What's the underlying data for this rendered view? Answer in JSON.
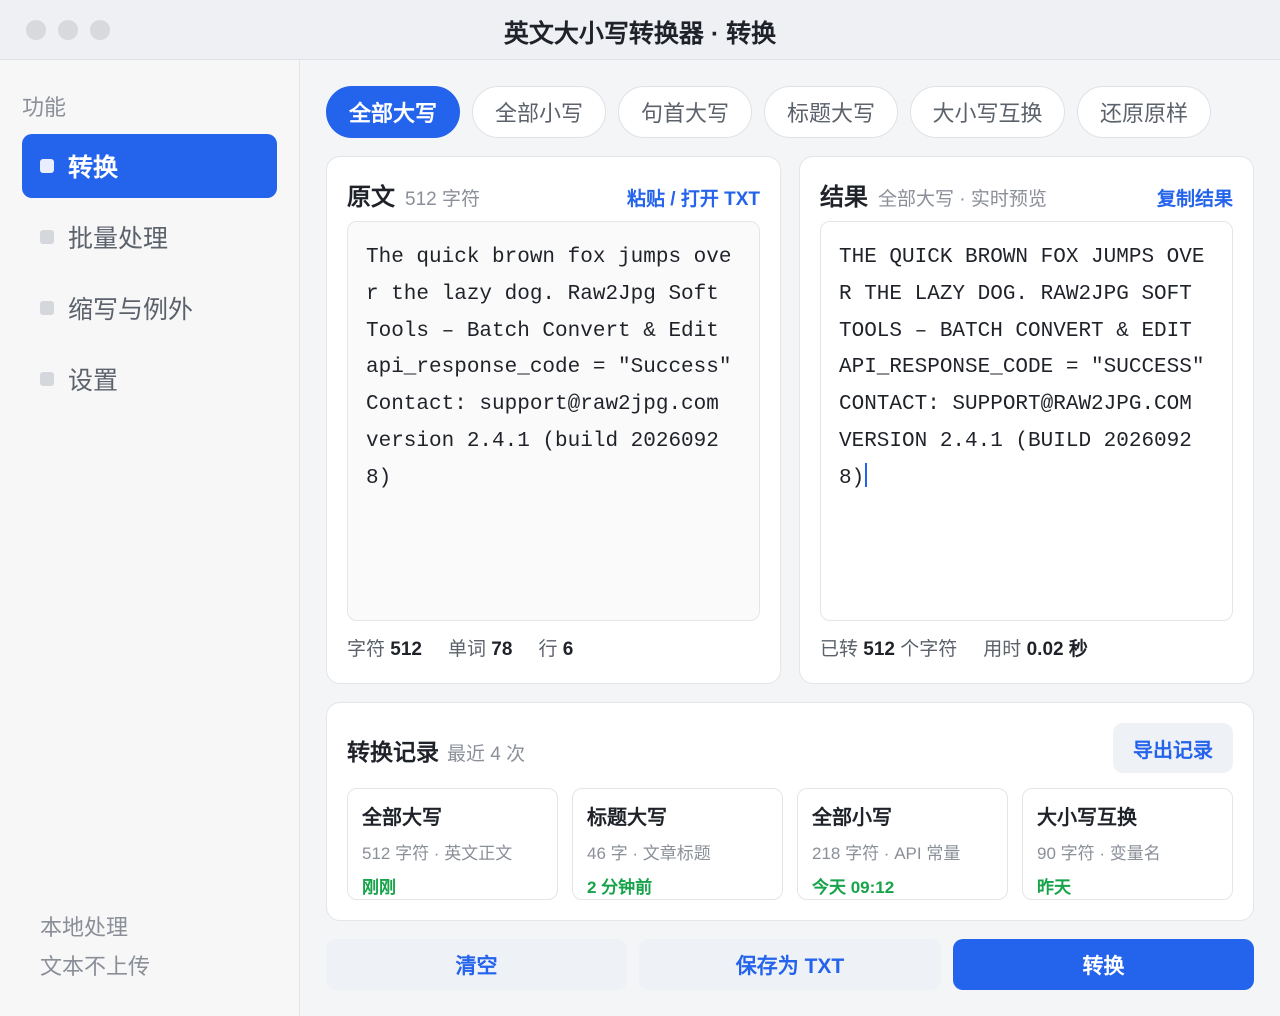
{
  "window": {
    "title": "英文大小写转换器 · 转换"
  },
  "sidebar": {
    "heading": "功能",
    "items": [
      {
        "label": "转换",
        "active": true
      },
      {
        "label": "批量处理",
        "active": false
      },
      {
        "label": "缩写与例外",
        "active": false
      },
      {
        "label": "设置",
        "active": false
      }
    ],
    "footer_line1": "本地处理",
    "footer_line2": "文本不上传"
  },
  "modes": [
    {
      "label": "全部大写",
      "active": true
    },
    {
      "label": "全部小写",
      "active": false
    },
    {
      "label": "句首大写",
      "active": false
    },
    {
      "label": "标题大写",
      "active": false
    },
    {
      "label": "大小写互换",
      "active": false
    },
    {
      "label": "还原原样",
      "active": false
    }
  ],
  "source": {
    "title": "原文",
    "count": "512 字符",
    "action": "粘贴 / 打开 TXT",
    "text": "The quick brown fox jumps over the lazy dog. Raw2Jpg Soft Tools – Batch Convert & Edit api_response_code = \"Success\" Contact: support@raw2jpg.com version 2.4.1 (build 20260928)",
    "stats": {
      "chars_label": "字符",
      "chars": "512",
      "words_label": "单词",
      "words": "78",
      "lines_label": "行",
      "lines": "6"
    }
  },
  "result": {
    "title": "结果",
    "subtitle": "全部大写 · 实时预览",
    "action": "复制结果",
    "text": "THE QUICK BROWN FOX JUMPS OVER THE LAZY DOG. RAW2JPG SOFT TOOLS – BATCH CONVERT & EDIT API_RESPONSE_CODE = \"SUCCESS\" CONTACT: SUPPORT@RAW2JPG.COM VERSION 2.4.1 (BUILD 20260928)",
    "stats": {
      "converted_prefix": "已转",
      "converted": "512",
      "converted_suffix": "个字符",
      "time_label": "用时",
      "time": "0.02 秒"
    }
  },
  "history": {
    "title": "转换记录",
    "subtitle": "最近 4 次",
    "export_label": "导出记录",
    "items": [
      {
        "mode": "全部大写",
        "meta": "512 字符 · 英文正文",
        "time": "刚刚"
      },
      {
        "mode": "标题大写",
        "meta": "46 字 · 文章标题",
        "time": "2 分钟前"
      },
      {
        "mode": "全部小写",
        "meta": "218 字符 · API 常量",
        "time": "今天 09:12"
      },
      {
        "mode": "大小写互换",
        "meta": "90 字符 · 变量名",
        "time": "昨天"
      }
    ]
  },
  "actions": {
    "clear": "清空",
    "save": "保存为 TXT",
    "convert": "转换"
  },
  "colors": {
    "accent": "#2463eb",
    "success": "#16a34a",
    "muted": "#8a8f98"
  }
}
